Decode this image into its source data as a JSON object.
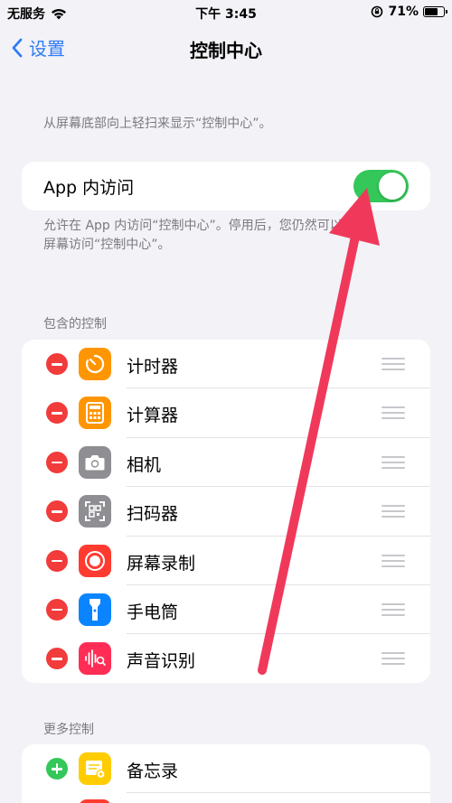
{
  "status_bar": {
    "carrier": "无服务",
    "time": "下午 3:45",
    "battery_percent": "71%",
    "battery_level": 0.71
  },
  "nav": {
    "back_label": "设置",
    "title": "控制中心"
  },
  "intro_note": "从屏幕底部向上轻扫来显示“控制中心”。",
  "in_app_access": {
    "label": "App 内访问",
    "enabled": true,
    "note_line1": "允许在 App 内访问“控制中心”。停用后，您仍然可以从主",
    "note_line2": "屏幕访问“控制中心”。"
  },
  "included": {
    "header": "包含的控制",
    "items": [
      {
        "label": "计时器",
        "icon": "timer-icon",
        "color": "#ff9500"
      },
      {
        "label": "计算器",
        "icon": "calculator-icon",
        "color": "#ff9500"
      },
      {
        "label": "相机",
        "icon": "camera-icon",
        "color": "#8e8e93"
      },
      {
        "label": "扫码器",
        "icon": "qr-scanner-icon",
        "color": "#8e8e93"
      },
      {
        "label": "屏幕录制",
        "icon": "screen-recording-icon",
        "color": "#ff3b30"
      },
      {
        "label": "手电筒",
        "icon": "flashlight-icon",
        "color": "#0a84ff"
      },
      {
        "label": "声音识别",
        "icon": "sound-recognition-icon",
        "color": "#ff2d55"
      }
    ]
  },
  "more": {
    "header": "更多控制",
    "items": [
      {
        "label": "备忘录",
        "icon": "notes-icon",
        "color": "#ffcc00"
      }
    ]
  },
  "colors": {
    "accent": "#2f7cf6",
    "toggle_on": "#34c759",
    "remove": "#f23b3b",
    "annotation_arrow": "#f0395a"
  }
}
